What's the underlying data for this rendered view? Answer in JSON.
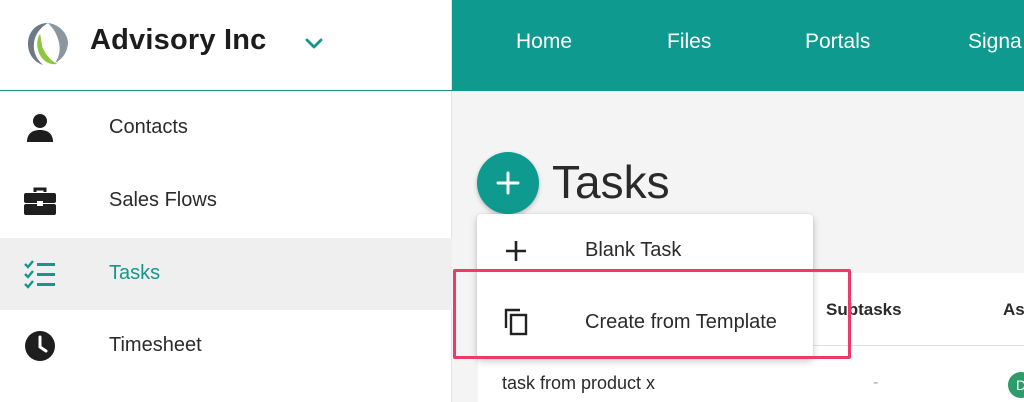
{
  "brand": {
    "name": "Advisory Inc",
    "logo_icon": "advisory-logo",
    "menu_icon": "chevron-down-icon"
  },
  "sidebar": {
    "items": [
      {
        "label": "Contacts",
        "icon": "person-icon",
        "active": false
      },
      {
        "label": "Sales Flows",
        "icon": "briefcase-icon",
        "active": false
      },
      {
        "label": "Tasks",
        "icon": "checklist-icon",
        "active": true
      },
      {
        "label": "Timesheet",
        "icon": "clock-icon",
        "active": false
      }
    ]
  },
  "topnav": {
    "items": [
      {
        "label": "Home"
      },
      {
        "label": "Files"
      },
      {
        "label": "Portals"
      },
      {
        "label": "Signa"
      }
    ]
  },
  "main": {
    "title": "Tasks",
    "add_icon": "plus-icon"
  },
  "add_menu": {
    "items": [
      {
        "label": "Blank Task",
        "icon": "plus-icon"
      },
      {
        "label": "Create from Template",
        "icon": "copy-icon"
      }
    ]
  },
  "table": {
    "columns": [
      "Subtasks",
      "As"
    ],
    "rows": [
      {
        "name": "task from product x",
        "subtasks": "-",
        "assignee_initial": "D"
      }
    ]
  },
  "colors": {
    "accent": "#0e9a8e",
    "highlight": "#ec3b6b"
  }
}
